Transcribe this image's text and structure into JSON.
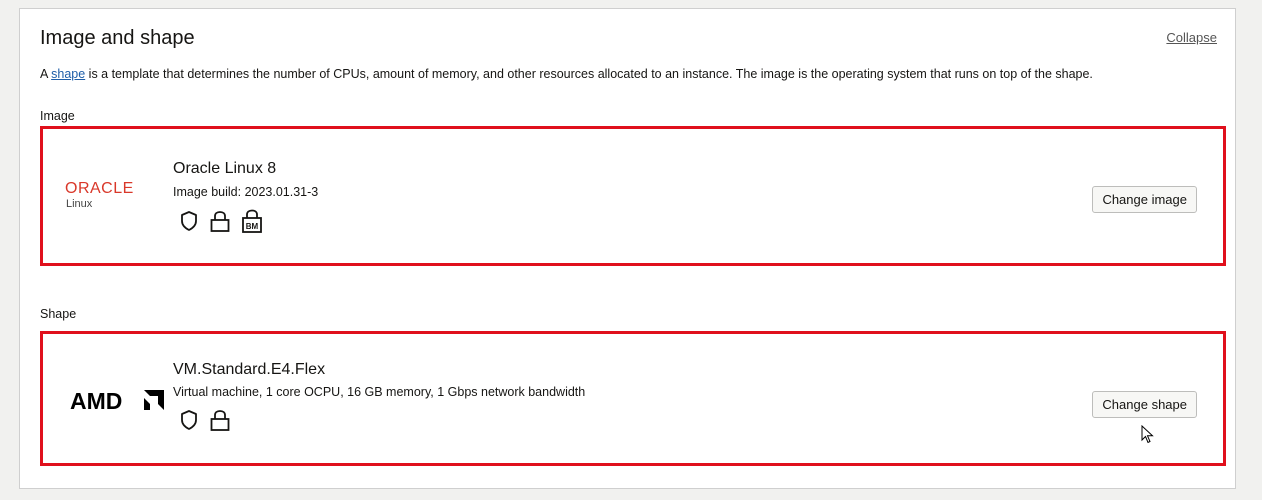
{
  "section": {
    "title": "Image and shape",
    "collapse_label": "Collapse",
    "description_prefix": "A ",
    "description_link": "shape",
    "description_suffix": " is a template that determines the number of CPUs, amount of memory, and other resources allocated to an instance. The image is the operating system that runs on top of the shape."
  },
  "image": {
    "label": "Image",
    "logo_text": "ORACLE",
    "logo_subtext": "Linux",
    "name": "Oracle Linux 8",
    "build": "Image build: 2023.01.31-3",
    "badges": [
      "shield-icon",
      "lock-icon",
      "bm-lock-icon"
    ],
    "badge_bm_text": "BM",
    "button_label": "Change image"
  },
  "shape": {
    "label": "Shape",
    "logo_text": "AMD",
    "name": "VM.Standard.E4.Flex",
    "details": "Virtual machine, 1 core OCPU, 16 GB memory, 1 Gbps network bandwidth",
    "badges": [
      "shield-icon",
      "lock-icon"
    ],
    "button_label": "Change shape"
  },
  "colors": {
    "highlight_border": "#e0101c",
    "oracle_red": "#d9382a",
    "link_blue": "#1f5ea8"
  }
}
